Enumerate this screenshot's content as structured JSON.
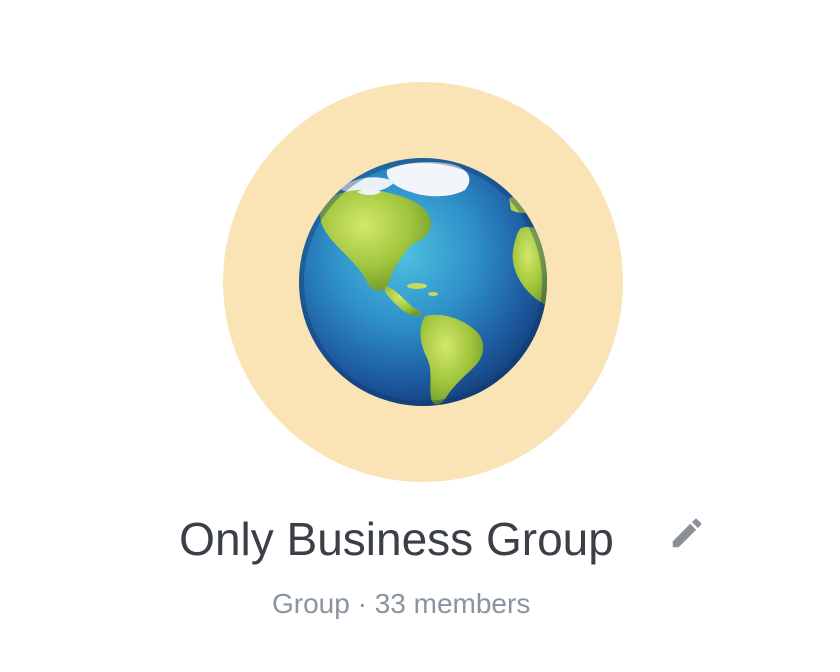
{
  "group": {
    "title": "Only Business Group",
    "type_label": "Group",
    "separator": "·",
    "members_label": "33 members"
  },
  "avatar": {
    "emoji": "globe-americas",
    "background_color": "#fae4b6"
  },
  "icons": {
    "edit": "pencil-icon"
  },
  "colors": {
    "title": "#3b4048",
    "subtitle": "#8a94a0",
    "icon": "#8a9099"
  }
}
